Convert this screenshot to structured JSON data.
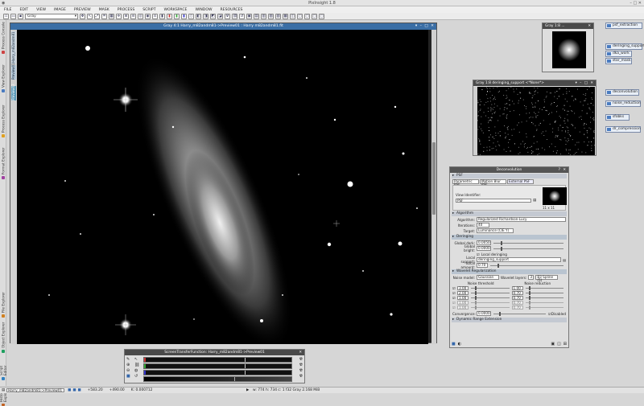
{
  "app": {
    "title": "PixInsight 1.8"
  },
  "menu": [
    "FILE",
    "EDIT",
    "VIEW",
    "IMAGE",
    "PREVIEW",
    "MASK",
    "PROCESS",
    "SCRIPT",
    "WORKSPACE",
    "WINDOW",
    "RESOURCES"
  ],
  "toolbar": {
    "mode_select": "Gray"
  },
  "left_tabs": [
    "Process Console",
    "View Explorer",
    "Process Explorer",
    "Format Explorer",
    "File Explorer",
    "Object Explorer",
    "Script Editor",
    "History Explorer"
  ],
  "image_window": {
    "title": "Gray 4:1 Harry_m82andm81->Preview01 : Harry m82andm81.fit",
    "side_tabs": [
      "Harry_m82andm81",
      "Preview01",
      "Preview02"
    ]
  },
  "psf_window": {
    "title": "Gray 1:8 ..."
  },
  "deringing_window": {
    "title": "Gray 1:8 deringing_support <*None*>"
  },
  "icons": [
    "psf_extraction",
    "deringing_support",
    "dka_work",
    "star_mask",
    "deconvolution",
    "noise_reduction",
    "sfobks",
    "dr_compression"
  ],
  "deconvolution": {
    "title": "Deconvolution",
    "psf_section": "PSF",
    "tabs": [
      "Parametric PSF",
      "Motion Blur PSF",
      "External PSF"
    ],
    "view_identifier_label": "View Identifier:",
    "view_identifier_value": "PSF",
    "psf_size": "11 x 11",
    "algorithm_section": "Algorithm",
    "algorithm_label": "Algorithm:",
    "algorithm_value": "Regularized Richardson-Lucy",
    "iterations_label": "Iterations:",
    "iterations_value": "40",
    "target_label": "Target:",
    "target_value": "Luminance (CIE Y)",
    "deringing_section": "Deringing",
    "global_dark_label": "Global dark:",
    "global_dark_value": "0.0050",
    "global_bright_label": "Global bright:",
    "global_bright_value": "0.0000",
    "local_deringing_label": "Local deringing",
    "local_support_label": "Local support:",
    "local_support_value": "deringing_support",
    "local_amount_label": "Local amount:",
    "local_amount_value": "0.70",
    "wavelet_section": "Wavelet Regularization",
    "noise_model_label": "Noise model:",
    "noise_model_value": "Gaussian",
    "wavelet_layers_label": "Wavelet layers:",
    "wavelet_layers_value": "3",
    "wavelet_kind": "B3 Spline (5)",
    "noise_threshold_label": "Noise threshold",
    "noise_reduction_label": "Noise reduction",
    "thresholds": [
      "3.00",
      "2.00",
      "1.00",
      "1.00",
      "1.00"
    ],
    "reductions": [
      "1.00",
      "0.70",
      "0.70",
      "0.70",
      "0.70"
    ],
    "convergence_label": "Convergence:",
    "convergence_value": "0.0000",
    "disabled_label": "Disabled",
    "dynamic_range_section": "Dynamic Range Extension"
  },
  "stf": {
    "title": "ScreenTransferFunction: Harry_m82andm81->Preview01"
  },
  "status": {
    "view": "Harry_m82andm81->Preview01",
    "coords_x": "+583.20",
    "coords_y": "+490.00",
    "value": "K: 0.000712",
    "info": "w: 774  h: 734  c: 1  f32  Gray  2.168 MiB"
  },
  "colors": {
    "accent": "#3a6ea5",
    "window_header": "#4a4a4a"
  }
}
